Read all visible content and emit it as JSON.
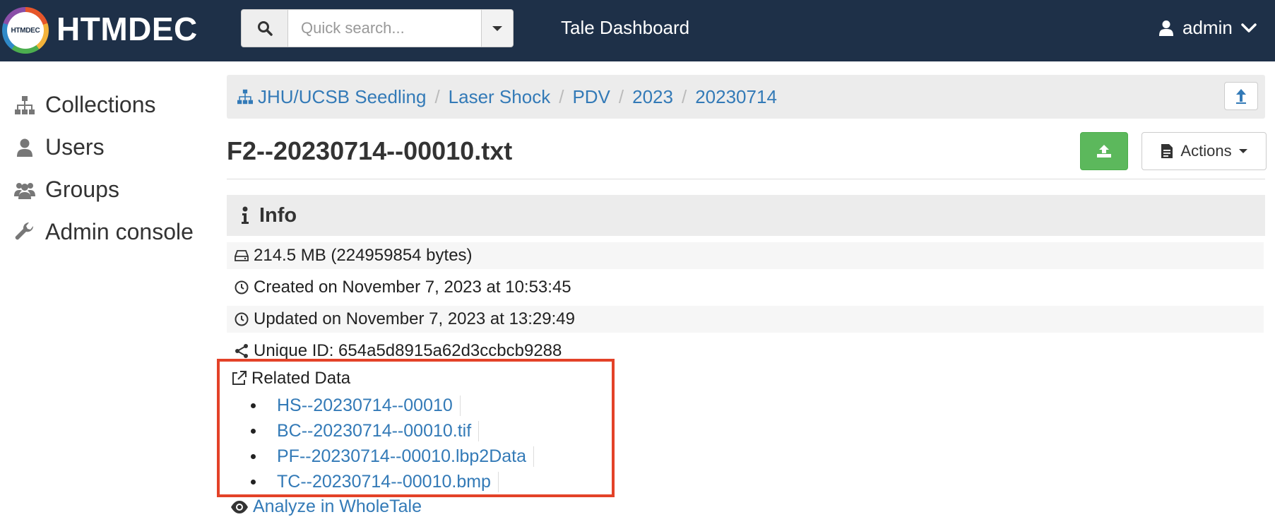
{
  "navbar": {
    "logo_text": "HTMDEC",
    "brand": "HTMDEC",
    "search_placeholder": "Quick search...",
    "tale_link": "Tale Dashboard",
    "user": "admin",
    "bg_color": "#1e3048"
  },
  "sidebar": {
    "items": [
      {
        "label": "Collections",
        "icon": "sitemap-icon"
      },
      {
        "label": "Users",
        "icon": "user-icon"
      },
      {
        "label": "Groups",
        "icon": "users-icon"
      },
      {
        "label": "Admin console",
        "icon": "wrench-icon"
      }
    ]
  },
  "breadcrumb": {
    "items": [
      "JHU/UCSB Seedling",
      "Laser Shock",
      "PDV",
      "2023",
      "20230714"
    ]
  },
  "file": {
    "title": "F2--20230714--00010.txt",
    "actions_label": "Actions"
  },
  "info": {
    "heading": "Info",
    "size": "214.5 MB (224959854 bytes)",
    "created": "Created on November 7, 2023 at 10:53:45",
    "updated": "Updated on November 7, 2023 at 13:29:49",
    "unique_id": "Unique ID: 654a5d8915a62d3ccbcb9288"
  },
  "related": {
    "heading": "Related Data",
    "items": [
      "HS--20230714--00010",
      "BC--20230714--00010.tif",
      "PF--20230714--00010.lbp2Data",
      "TC--20230714--00010.bmp"
    ],
    "highlight_color": "#e34228"
  },
  "analyze": {
    "label": "Analyze in WholeTale"
  },
  "colors": {
    "link": "#337ab7",
    "success": "#5cb85c"
  }
}
